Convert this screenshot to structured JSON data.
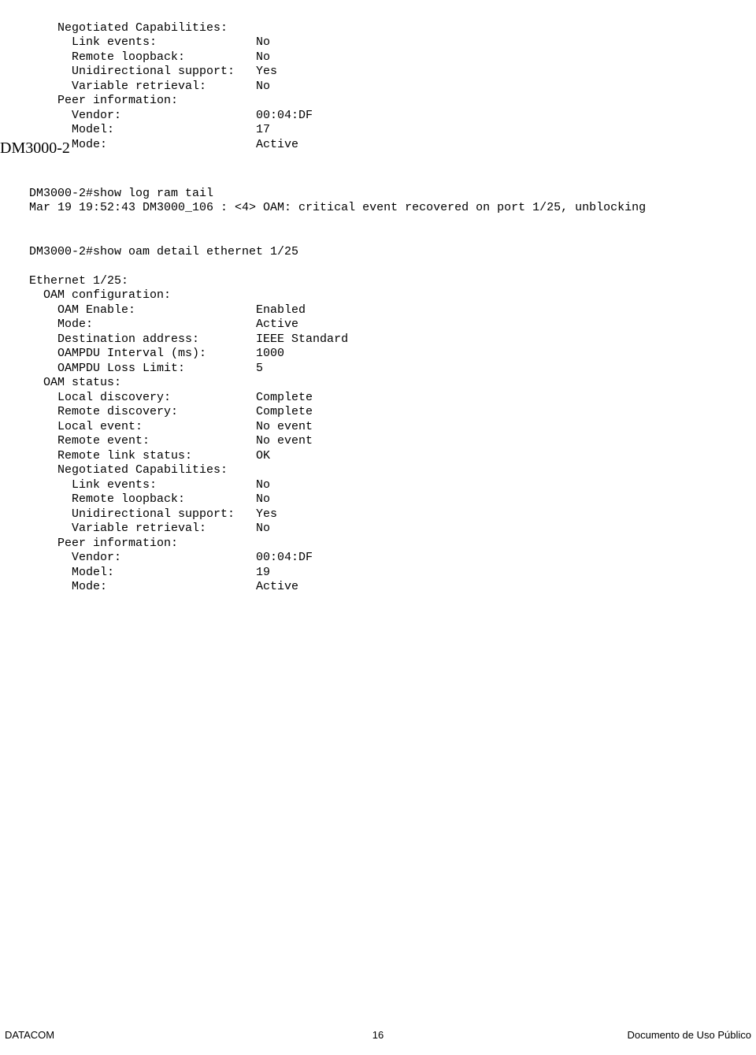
{
  "block1": {
    "l1": "    Negotiated Capabilities:",
    "l2k": "      Link events:",
    "l2v": "No",
    "l3k": "      Remote loopback:",
    "l3v": "No",
    "l4k": "      Unidirectional support:",
    "l4v": "Yes",
    "l5k": "      Variable retrieval:",
    "l5v": "No",
    "l6": "    Peer information:",
    "l7k": "      Vendor:",
    "l7v": "00:04:DF",
    "l8k": "      Model:",
    "l8v": "17",
    "l9k": "      Mode:",
    "l9v": "Active"
  },
  "heading": "DM3000-2",
  "block2": {
    "l1": "DM3000-2#show log ram tail",
    "l2": "Mar 19 19:52:43 DM3000_106 : <4> OAM: critical event recovered on port 1/25, unblocking"
  },
  "block3": {
    "l1": "DM3000-2#show oam detail ethernet 1/25"
  },
  "block4": {
    "l1": "Ethernet 1/25:",
    "l2": "  OAM configuration:",
    "l3k": "    OAM Enable:",
    "l3v": "Enabled",
    "l4k": "    Mode:",
    "l4v": "Active",
    "l5k": "    Destination address:",
    "l5v": "IEEE Standard",
    "l6k": "    OAMPDU Interval (ms):",
    "l6v": "1000",
    "l7k": "    OAMPDU Loss Limit:",
    "l7v": "5",
    "l8": "  OAM status:",
    "l9k": "    Local discovery:",
    "l9v": "Complete",
    "l10k": "    Remote discovery:",
    "l10v": "Complete",
    "l11k": "    Local event:",
    "l11v": "No event",
    "l12k": "    Remote event:",
    "l12v": "No event",
    "l13k": "    Remote link status:",
    "l13v": "OK",
    "l14": "    Negotiated Capabilities:",
    "l15k": "      Link events:",
    "l15v": "No",
    "l16k": "      Remote loopback:",
    "l16v": "No",
    "l17k": "      Unidirectional support:",
    "l17v": "Yes",
    "l18k": "      Variable retrieval:",
    "l18v": "No",
    "l19": "    Peer information:",
    "l20k": "      Vendor:",
    "l20v": "00:04:DF",
    "l21k": "      Model:",
    "l21v": "19",
    "l22k": "      Mode:",
    "l22v": "Active"
  },
  "footer": {
    "left": "DATACOM",
    "center": "16",
    "right": "Documento de Uso Público"
  }
}
